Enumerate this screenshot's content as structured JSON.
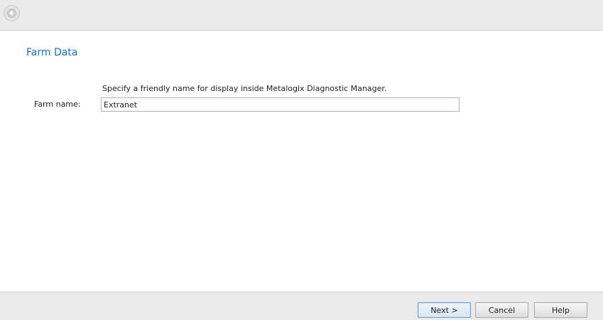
{
  "header": {
    "back_icon": "back-arrow-icon"
  },
  "page": {
    "title": "Farm Data",
    "instruction": "Specify a friendly name for display inside Metalogix Diagnostic Manager."
  },
  "form": {
    "farm_name_label": "Farm name:",
    "farm_name_value": "Extranet"
  },
  "footer": {
    "next_label": "Next >",
    "cancel_label": "Cancel",
    "help_label": "Help"
  },
  "colors": {
    "title": "#1f6fb2",
    "chrome": "#eaeaea",
    "primary_button_border": "#6f9fd1"
  }
}
